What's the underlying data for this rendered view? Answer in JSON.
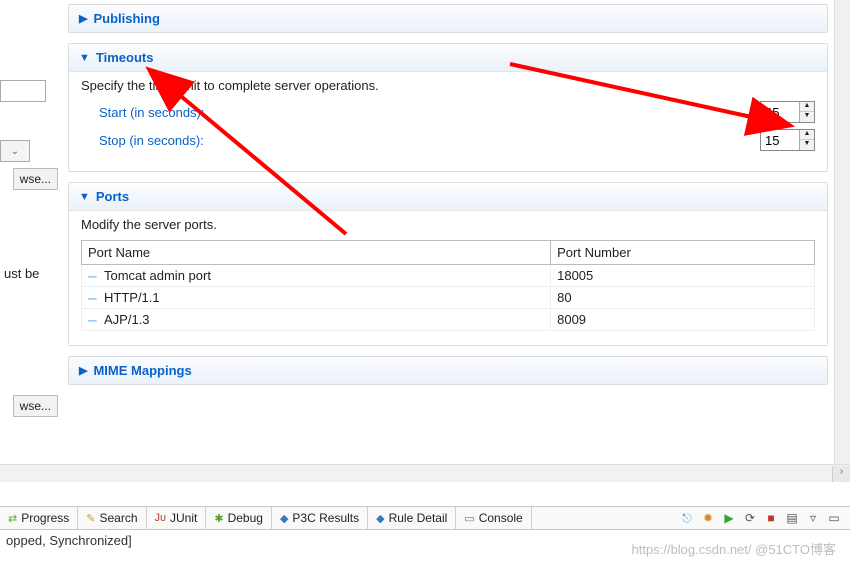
{
  "left": {
    "browse1": "wse...",
    "browse2": "wse...",
    "text1": "ust be"
  },
  "sections": {
    "publishing": {
      "title": "Publishing"
    },
    "timeouts": {
      "title": "Timeouts",
      "desc": "Specify the time limit to complete server operations.",
      "start_label": "Start (in seconds):",
      "start_value": "45",
      "stop_label": "Stop (in seconds):",
      "stop_value": "15"
    },
    "ports": {
      "title": "Ports",
      "desc": "Modify the server ports.",
      "col_name": "Port Name",
      "col_number": "Port Number",
      "rows": [
        {
          "name": "Tomcat admin port",
          "number": "18005"
        },
        {
          "name": "HTTP/1.1",
          "number": "80"
        },
        {
          "name": "AJP/1.3",
          "number": "8009"
        }
      ]
    },
    "mime": {
      "title": "MIME Mappings"
    }
  },
  "tabs": [
    {
      "icon": "⇄",
      "iconColor": "#6cae3e",
      "label": "Progress"
    },
    {
      "icon": "✎",
      "iconColor": "#c59a2e",
      "label": "Search"
    },
    {
      "icon": "Jᴜ",
      "iconColor": "#c0392b",
      "label": "JUnit"
    },
    {
      "icon": "✱",
      "iconColor": "#5aa02c",
      "label": "Debug"
    },
    {
      "icon": "◆",
      "iconColor": "#3477c9",
      "label": "P3C Results"
    },
    {
      "icon": "◆",
      "iconColor": "#3477c9",
      "label": "Rule Detail"
    },
    {
      "icon": "▭",
      "iconColor": "#5a7aa0",
      "label": "Console"
    }
  ],
  "status": "opped, Synchronized]",
  "watermark": "https://blog.csdn.net/  @51CTO博客"
}
